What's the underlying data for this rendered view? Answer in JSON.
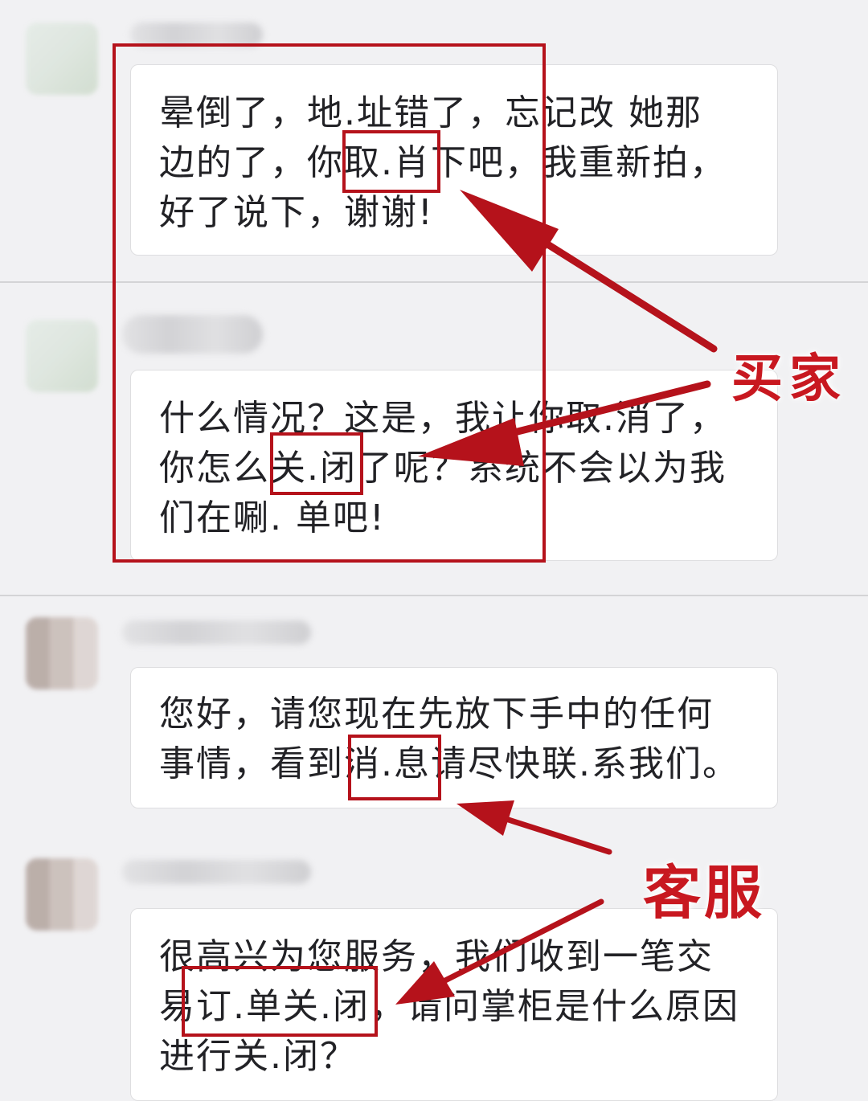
{
  "messages": [
    {
      "text": "晕倒了，地.址错了，忘记改 她那\n边的了，你取.肖下吧，我重新拍，\n好了说下，谢谢!"
    },
    {
      "text": "什么情况？这是，我让你取.消了，\n你怎么关.闭了呢？系统不会以为我\n们在唰. 单吧!"
    },
    {
      "text": "您好，请您现在先放下手中的任何\n事情，看到消.息请尽快联.系我们。"
    },
    {
      "text": "很高兴为您服务，我们收到一笔交\n易订.单关.闭，请问掌柜是什么原因\n进行关.闭？"
    }
  ],
  "annotations": {
    "buyer_label": "买家",
    "service_label": "客服",
    "accent_color": "#b5121b"
  }
}
